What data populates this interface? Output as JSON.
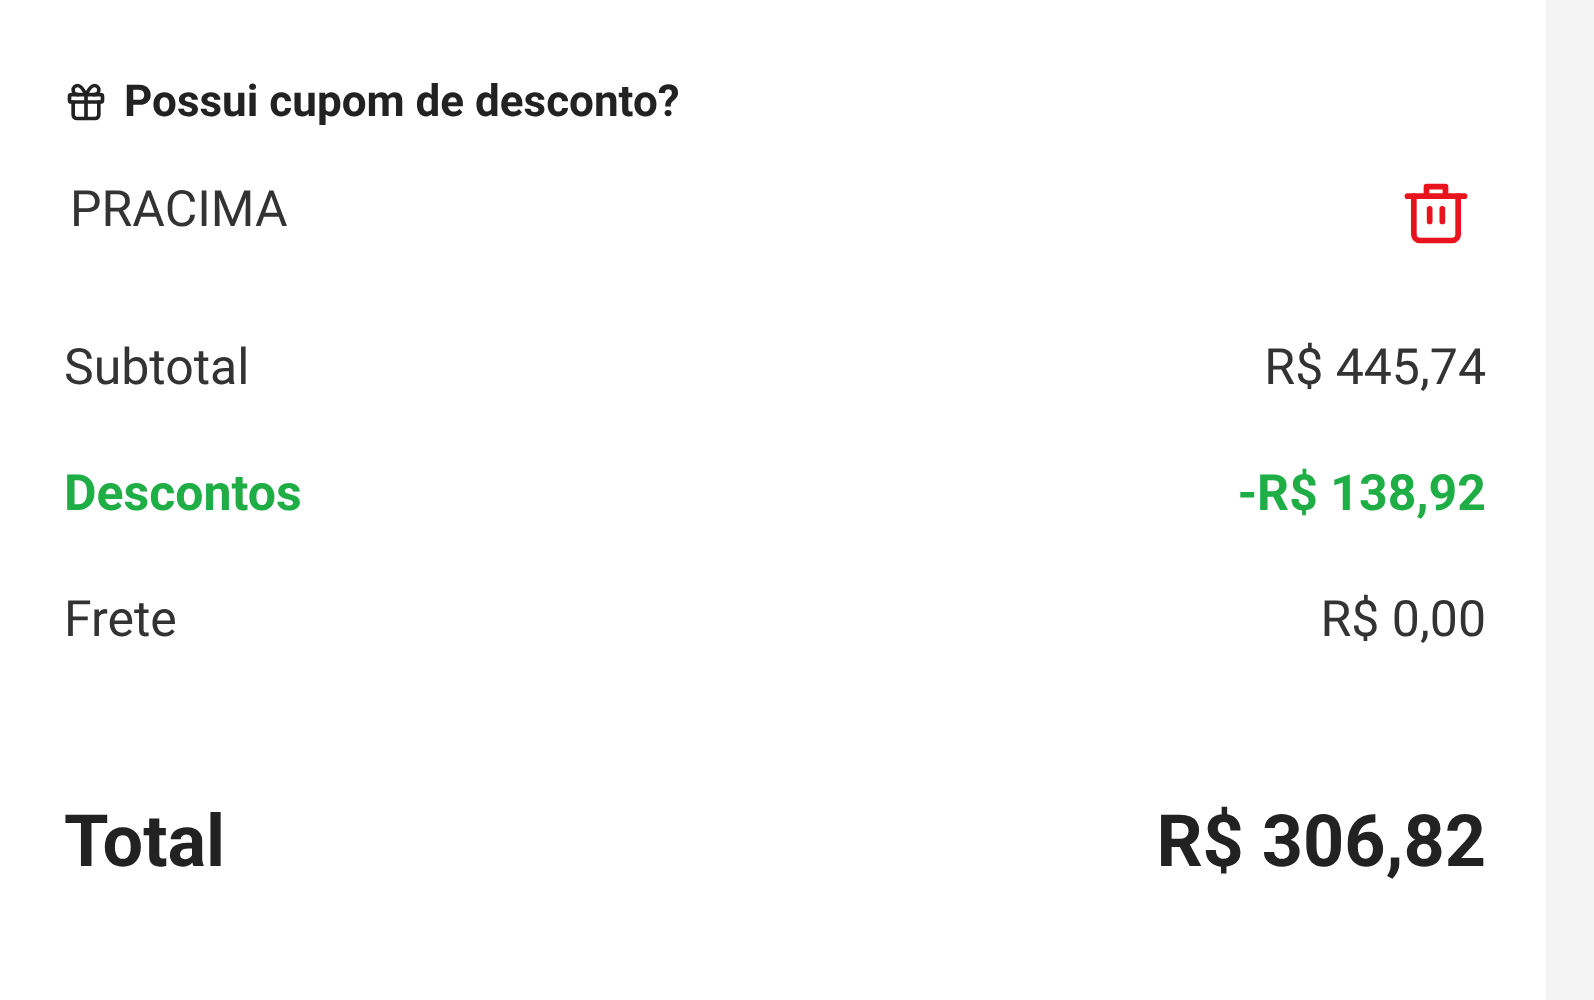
{
  "coupon": {
    "title": "Possui cupom de desconto?",
    "code": "PRACIMA"
  },
  "lines": [
    {
      "kind": "normal",
      "label": "Subtotal",
      "value": "R$ 445,74"
    },
    {
      "kind": "discount",
      "label": "Descontos",
      "value": "-R$ 138,92"
    },
    {
      "kind": "normal",
      "label": "Frete",
      "value": "R$ 0,00"
    }
  ],
  "total": {
    "label": "Total",
    "value": "R$ 306,82"
  }
}
